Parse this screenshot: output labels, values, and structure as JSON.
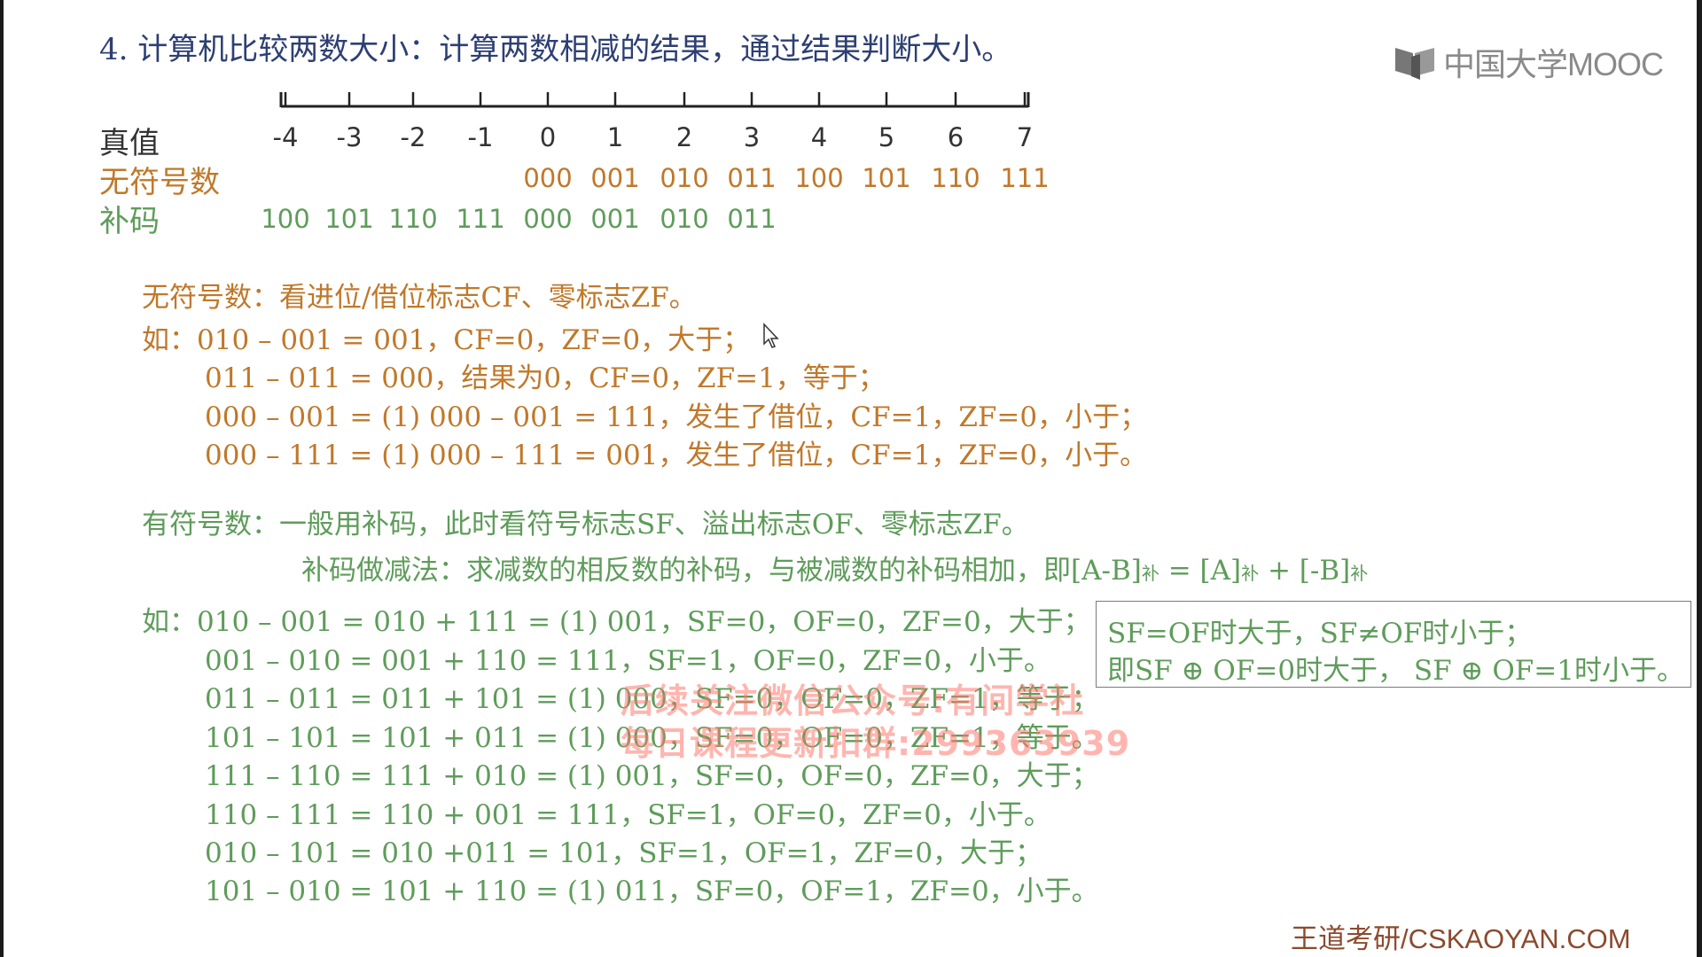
{
  "slide": {
    "title": "4. 计算机比较两数大小：计算两数相减的结果，通过结果判断大小。",
    "logo_text": "中国大学MOOC",
    "footer_brand": "王道考研/CSKAOYAN.COM"
  },
  "table": {
    "labels": {
      "true_value": "真值",
      "unsigned": "无符号数",
      "twos": "补码"
    },
    "true_values": [
      "-4",
      "-3",
      "-2",
      "-1",
      "0",
      "1",
      "2",
      "3",
      "4",
      "5",
      "6",
      "7"
    ],
    "unsigned": [
      "",
      "",
      "",
      "",
      "000",
      "001",
      "010",
      "011",
      "100",
      "101",
      "110",
      "111"
    ],
    "twos_complement": [
      "100",
      "101",
      "110",
      "111",
      "000",
      "001",
      "010",
      "011",
      "",
      "",
      "",
      ""
    ]
  },
  "unsigned_section": {
    "heading": "无符号数：看进位/借位标志CF、零标志ZF。",
    "examples": [
      "如：010 – 001 = 001，CF=0，ZF=0，大于；",
      "011 – 011 = 000，结果为0，CF=0，ZF=1，等于；",
      "000 – 001 = (1) 000 – 001 = 111，发生了借位，CF=1，ZF=0，小于；",
      "000 – 111 = (1) 000 – 111 = 001，发生了借位，CF=1，ZF=0，小于。"
    ]
  },
  "signed_section": {
    "heading": "有符号数：一般用补码，此时看符号标志SF、溢出标志OF、零标志ZF。",
    "method_text": "补码做减法：求减数的相反数的补码，与被减数的补码相加，即",
    "method_formula": {
      "lhs": "[A-B]",
      "eq": " = ",
      "a": "[A]",
      "plus": " + ",
      "b": "[-B]",
      "sub": "补"
    },
    "examples": [
      "如：010 – 001 = 010 + 111 = (1) 001，SF=0，OF=0，ZF=0，大于；",
      "001 – 010 = 001 + 110 = 111，SF=1，OF=0，ZF=0，小于。",
      "011 – 011 = 011 + 101 = (1) 000，SF=0，OF=0，ZF=1，等于；",
      "101 – 101 = 101 + 011 = (1) 000，SF=0，OF=0，ZF=1，等于。",
      "111 – 110 = 111 + 010 = (1) 001，SF=0，OF=0，ZF=0，大于；",
      "110 – 111 = 110 + 001 = 111，SF=1，OF=0，ZF=0，小于。",
      "010 – 101 = 010 +011 = 101，SF=1，OF=1，ZF=0，大于；",
      "101 – 010  = 101 + 110 = (1) 011，SF=0，OF=1，ZF=0，小于。"
    ]
  },
  "formula_box": {
    "line1": "SF=OF时大于，SF≠OF时小于；",
    "line2": "即SF ⊕ OF=0时大于，  SF ⊕ OF=1时小于。"
  },
  "watermark": {
    "line1": "后续关注微信公众号:有间学社",
    "line2": "每日课程更新扣群:299363939"
  },
  "colors": {
    "title": "#2d3f73",
    "unsigned": "#c0782a",
    "signed": "#5e9c5a",
    "footer": "#8b4a2e",
    "watermark": "#ff786e"
  }
}
